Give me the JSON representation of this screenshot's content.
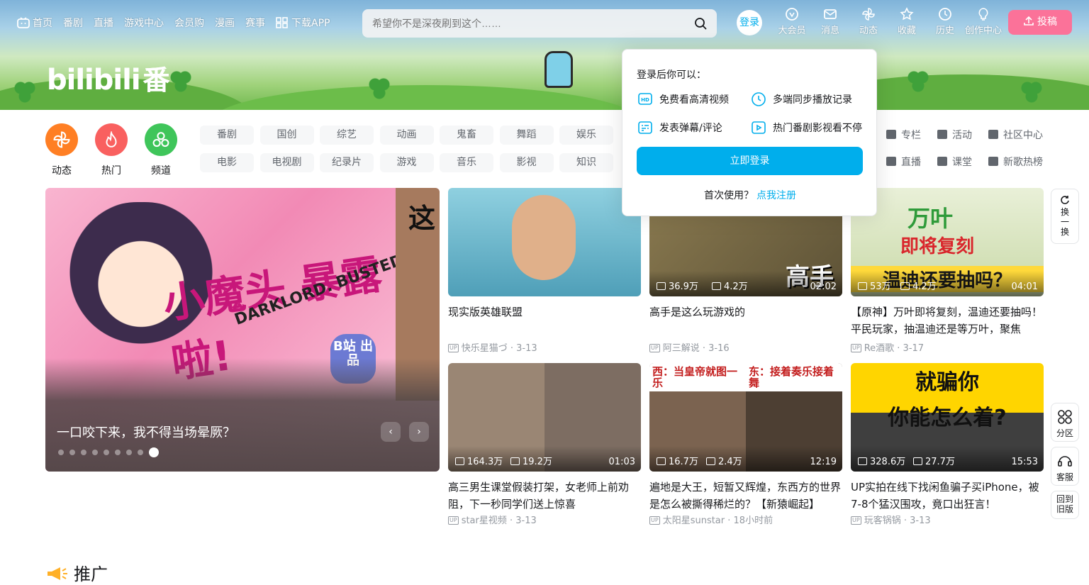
{
  "nav": {
    "left_items": [
      "首页",
      "番剧",
      "直播",
      "游戏中心",
      "会员购",
      "漫画",
      "赛事"
    ],
    "download_app": "下载APP",
    "search_placeholder": "希望你不是深夜刷到这个……",
    "login_avatar": "登录",
    "right_items": [
      "大会员",
      "消息",
      "动态",
      "收藏",
      "历史",
      "创作中心"
    ],
    "upload": "投稿"
  },
  "logo": {
    "text": "bilibili",
    "suffix": "番"
  },
  "channels": {
    "primary": [
      {
        "label": "动态",
        "color": "#ff7f24",
        "icon": "dynamic-icon"
      },
      {
        "label": "热门",
        "color": "#f9605f",
        "icon": "fire-icon"
      },
      {
        "label": "频道",
        "color": "#3fc55a",
        "icon": "channel-icon"
      }
    ],
    "tags_row1": [
      "番剧",
      "国创",
      "综艺",
      "动画",
      "鬼畜",
      "舞蹈",
      "娱乐"
    ],
    "tags_row2": [
      "电影",
      "电视剧",
      "纪录片",
      "游戏",
      "音乐",
      "影视",
      "知识"
    ],
    "secondary": [
      "专栏",
      "活动",
      "社区中心",
      "直播",
      "课堂",
      "新歌热榜"
    ]
  },
  "carousel": {
    "caption": "一口咬下来，我不得当场晕厥？",
    "art_title": "小魔头 暴露啦!",
    "art_sub": "DARKLORD. BUSTED!",
    "strip_text": "这",
    "badge": "B站 出品",
    "dots": 9,
    "active_dot": 8,
    "prev": "‹",
    "next": "›"
  },
  "videos": [
    {
      "title": "现实版英雄联盟",
      "author": "快乐星猫づ",
      "date": "3-13",
      "plays": "",
      "likes": "",
      "duration": "",
      "bg": "#6fb4c9"
    },
    {
      "title": "高手是这么玩游戏的",
      "author": "阿三解说",
      "date": "3-16",
      "plays": "36.9万",
      "likes": "4.2万",
      "duration": "02:02",
      "bg": "#7a6a48",
      "overlay": "高手"
    },
    {
      "title": "【原神】万叶即将复刻，温迪还要抽吗！平民玩家，抽温迪还是等万叶，聚焦",
      "author": "Re酒歌",
      "date": "3-17",
      "plays": "53万",
      "likes": "4.2万",
      "duration": "04:01",
      "bg": "#d9e6c2",
      "overlay": "万叶 即将复刻 温迪还要抽吗？"
    },
    {
      "title": "高三男生课堂假装打架，女老师上前劝阻，下一秒同学们送上惊喜",
      "author": "star星视频",
      "date": "3-13",
      "plays": "164.3万",
      "likes": "19.2万",
      "duration": "01:03",
      "bg": "#8b7a6c"
    },
    {
      "title": "遍地是大王，短暂又辉煌，东西方的世界是怎么被撕得稀烂的？【新猿崛起】",
      "author": "太阳星sunstar",
      "date": "18小时前",
      "plays": "16.7万",
      "likes": "2.4万",
      "duration": "12:19",
      "bg": "#5a4a3a",
      "overlay": "西：当皇帝就图一乐 东：接着奏乐接着舞"
    },
    {
      "title": "UP实拍在线下找闲鱼骗子买iPhone，被7-8个猛汉围攻，竟口出狂言！",
      "author": "玩客锅锅",
      "date": "3-13",
      "plays": "328.6万",
      "likes": "27.7万",
      "duration": "15:53",
      "bg": "#4a4a4a",
      "overlay": "就骗你 你能怎么着?"
    }
  ],
  "side": {
    "refresh": "换一换",
    "zone": "分区",
    "service": "客服",
    "back": "回到旧版"
  },
  "promo": "推广",
  "login_popup": {
    "heading": "登录后你可以：",
    "features": [
      "免费看高清视频",
      "多端同步播放记录",
      "发表弹幕/评论",
      "热门番剧影视看不停"
    ],
    "button": "立即登录",
    "first_use": "首次使用？",
    "register": "点我注册"
  }
}
